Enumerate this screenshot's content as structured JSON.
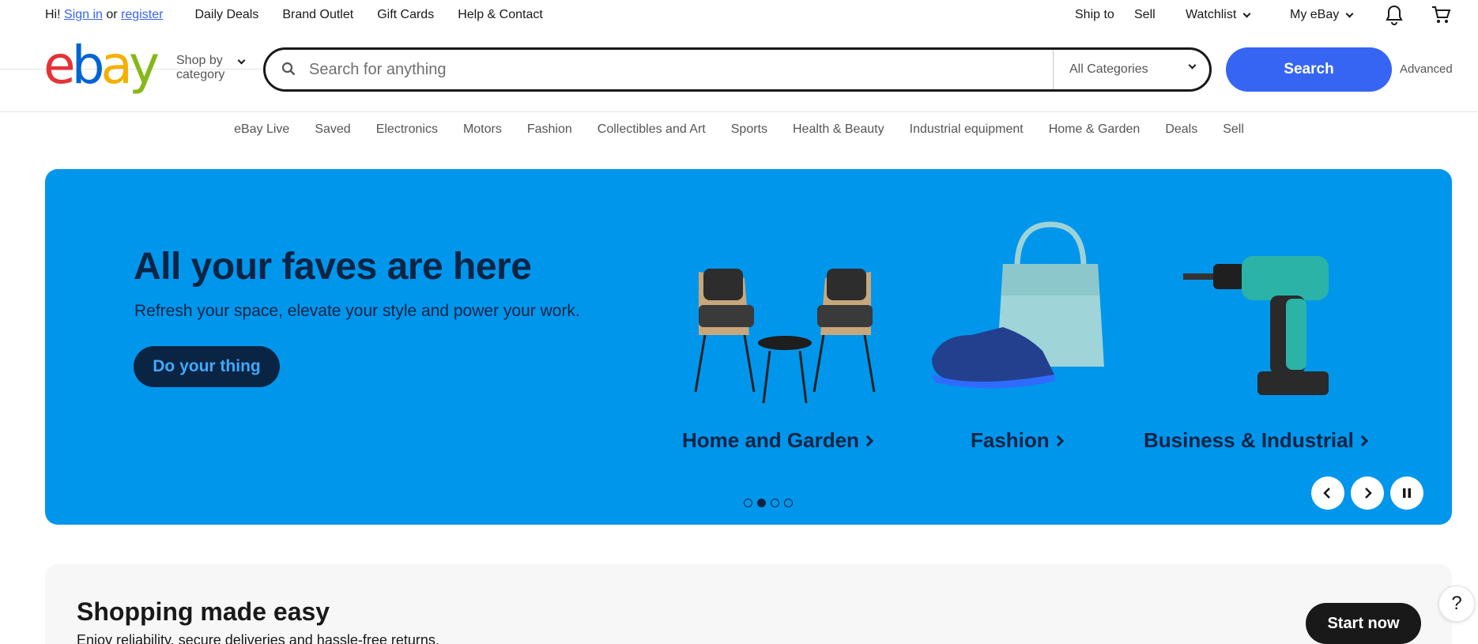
{
  "topbar": {
    "greeting": "Hi!",
    "sign_in": "Sign in",
    "or": "or",
    "register": "register",
    "nav": [
      "Daily Deals",
      "Brand Outlet",
      "Gift Cards",
      "Help & Contact"
    ],
    "ship_to": "Ship to",
    "sell": "Sell",
    "watchlist": "Watchlist",
    "my_ebay": "My eBay"
  },
  "header": {
    "logo": {
      "e": "e",
      "b": "b",
      "a": "a",
      "y": "y"
    },
    "shop_by_line1": "Shop by",
    "shop_by_line2": "category",
    "search_placeholder": "Search for anything",
    "categories_selected": "All Categories",
    "search_button": "Search",
    "advanced": "Advanced"
  },
  "catnav": [
    "eBay Live",
    "Saved",
    "Electronics",
    "Motors",
    "Fashion",
    "Collectibles and Art",
    "Sports",
    "Health & Beauty",
    "Industrial equipment",
    "Home & Garden",
    "Deals",
    "Sell"
  ],
  "hero": {
    "title": "All your faves are here",
    "subtitle": "Refresh your space, elevate your style and power your work.",
    "cta": "Do your thing",
    "tiles": [
      {
        "label": "Home and Garden"
      },
      {
        "label": "Fashion"
      },
      {
        "label": "Business & Industrial"
      }
    ],
    "active_slide": 2,
    "slide_count": 4,
    "colors": {
      "background": "#0096ec",
      "text": "#0a2444"
    }
  },
  "easy": {
    "title": "Shopping made easy",
    "description": "Enjoy reliability, secure deliveries and hassle-free returns.",
    "cta": "Start now"
  },
  "help": "?"
}
